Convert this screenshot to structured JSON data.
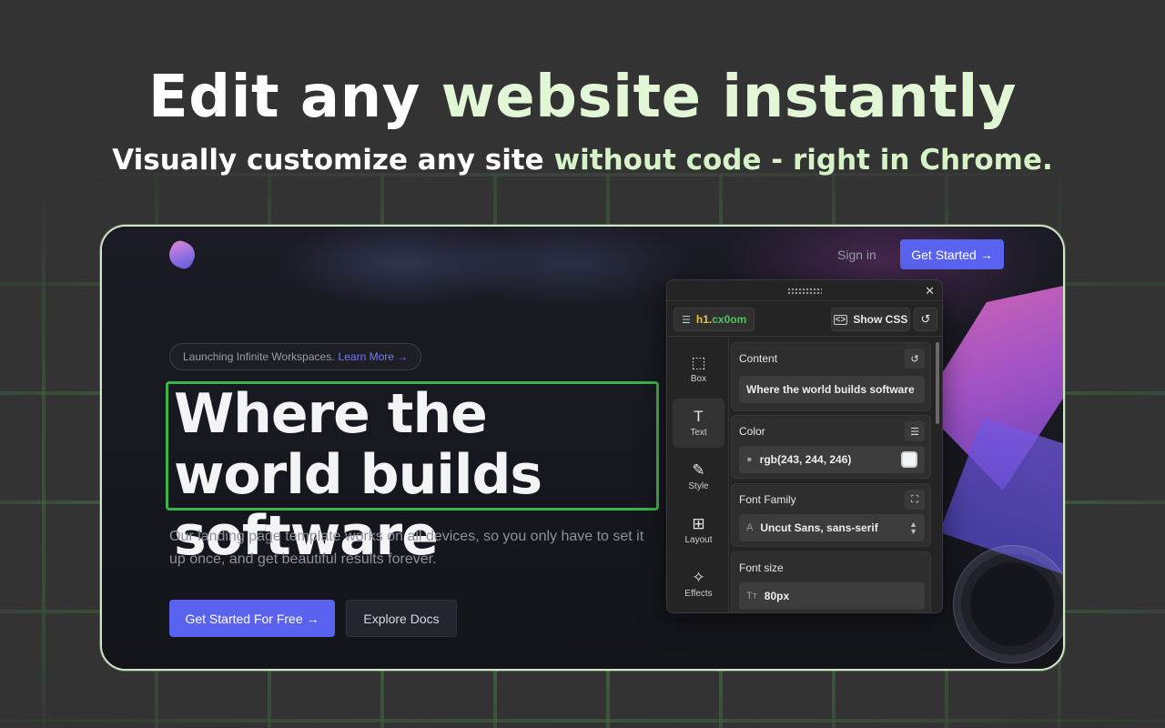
{
  "hero": {
    "title_part1": "Edit any",
    "title_part2": "website instantly",
    "subtitle_part1": "Visually customize any site",
    "subtitle_part2": "without code - right in Chrome."
  },
  "site": {
    "nav": {
      "signin": "Sign in",
      "cta": "Get Started →"
    },
    "pill": {
      "text": "Launching Infinite Workspaces.",
      "link": "Learn More →"
    },
    "headline": "Where the world builds software",
    "lead": "Our landing page template works on all devices, so you only have to set it up once, and get beautiful results forever.",
    "buttons": {
      "primary": "Get Started For Free →",
      "secondary": "Explore Docs"
    }
  },
  "panel": {
    "selector_tag": "h1.",
    "selector_id": "cx0om",
    "show_css": "Show CSS",
    "tabs": [
      {
        "label": "Box",
        "icon": "box-icon",
        "glyph": "⬚"
      },
      {
        "label": "Text",
        "icon": "text-icon",
        "glyph": "T"
      },
      {
        "label": "Style",
        "icon": "brush-icon",
        "glyph": "✎"
      },
      {
        "label": "Layout",
        "icon": "layout-icon",
        "glyph": "⊞"
      },
      {
        "label": "Effects",
        "icon": "wand-icon",
        "glyph": "✧"
      }
    ],
    "active_tab": "Text",
    "content": {
      "label": "Content",
      "value": "Where the world builds software"
    },
    "color": {
      "label": "Color",
      "value": "rgb(243, 244, 246)",
      "swatch": "#f3f4f6"
    },
    "font_family": {
      "label": "Font Family",
      "value": "Uncut Sans, sans-serif"
    },
    "font_size": {
      "label": "Font size",
      "value": "80px"
    }
  },
  "colors": {
    "background": "#333333",
    "accent_green": "#3ab54a",
    "primary_blue": "#5a63f0",
    "selector_yellow": "#e3c24b"
  }
}
